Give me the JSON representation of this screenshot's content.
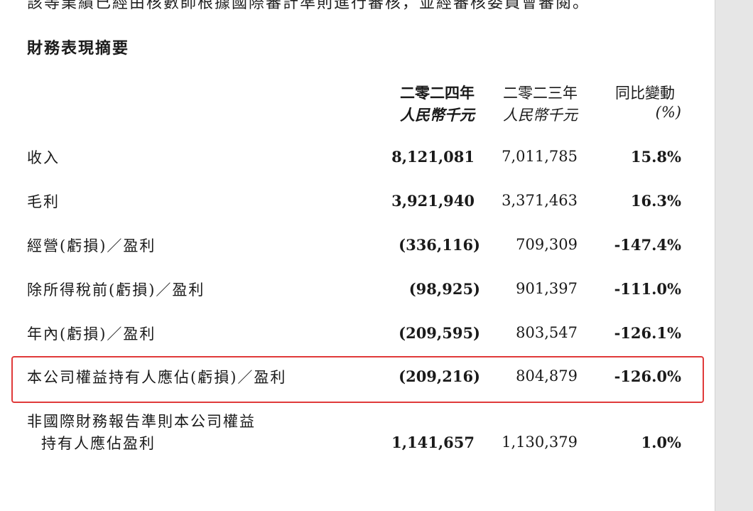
{
  "document": {
    "intro_text": "該等業績已經由核數師根據國際審計準則進行審核，並經審核委員會審閱。",
    "section_title": "財務表現摘要",
    "columns": {
      "y2024_line1": "二零二四年",
      "y2024_line2": "人民幣千元",
      "y2023_line1": "二零二三年",
      "y2023_line2": "人民幣千元",
      "yoy_line1": "同比變動",
      "yoy_line2": "(%)"
    },
    "rows": [
      {
        "label": "收入",
        "y2024": "8,121,081",
        "y2023": "7,011,785",
        "yoy": "15.8%"
      },
      {
        "label": "毛利",
        "y2024": "3,921,940",
        "y2023": "3,371,463",
        "yoy": "16.3%"
      },
      {
        "label": "經營(虧損)／盈利",
        "y2024": "(336,116)",
        "y2023": "709,309",
        "yoy": "-147.4%"
      },
      {
        "label": "除所得稅前(虧損)／盈利",
        "y2024": "(98,925)",
        "y2023": "901,397",
        "yoy": "-111.0%"
      },
      {
        "label": "年內(虧損)／盈利",
        "y2024": "(209,595)",
        "y2023": "803,547",
        "yoy": "-126.1%"
      },
      {
        "label": "本公司權益持有人應佔(虧損)／盈利",
        "y2024": "(209,216)",
        "y2023": "804,879",
        "yoy": "-126.0%",
        "highlighted": true
      },
      {
        "label_line1": "非國際財務報告準則本公司權益",
        "label_line2": "持有人應佔盈利",
        "y2024": "1,141,657",
        "y2023": "1,130,379",
        "yoy": "1.0%"
      }
    ],
    "colors": {
      "highlight_border": "#e03a3a",
      "text": "#1a1a1a",
      "page_background": "#ffffff",
      "gutter_background": "#e6e6e6"
    }
  }
}
